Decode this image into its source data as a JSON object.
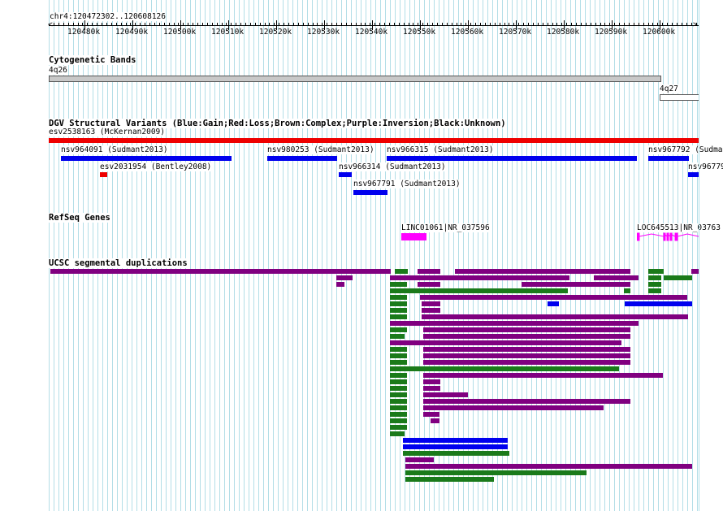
{
  "ruler": {
    "position": "chr4:120472302..120608126",
    "ticks": [
      "120480k",
      "120490k",
      "120500k",
      "120510k",
      "120520k",
      "120530k",
      "120540k",
      "120550k",
      "120560k",
      "120570k",
      "120580k",
      "120590k",
      "120600k"
    ]
  },
  "tracks": {
    "cytoband": {
      "title": "Cytogenetic Bands",
      "bands": [
        {
          "label": "4q26",
          "color": "#c8c8c8"
        },
        {
          "label": "4q27",
          "color": "#ffffff"
        }
      ]
    },
    "dgv": {
      "title": "DGV Structural Variants (Blue:Gain;Red:Loss;Brown:Complex;Purple:Inversion;Black:Unknown)",
      "variants": [
        {
          "label": "esv2538163 (McKernan2009)",
          "type": "loss"
        },
        {
          "label": "nsv964091 (Sudmant2013)",
          "type": "gain"
        },
        {
          "label": "nsv980253 (Sudmant2013)",
          "type": "gain"
        },
        {
          "label": "nsv966315 (Sudmant2013)",
          "type": "gain"
        },
        {
          "label": "nsv967792 (Sudma",
          "type": "gain"
        },
        {
          "label": "esv2031954 (Bentley2008)",
          "type": "loss"
        },
        {
          "label": "nsv966314 (Sudmant2013)",
          "type": "gain"
        },
        {
          "label": "nsv96779",
          "type": "gain"
        },
        {
          "label": "nsv967791 (Sudmant2013)",
          "type": "gain"
        }
      ]
    },
    "refseq": {
      "title": "RefSeq Genes",
      "genes": [
        {
          "label": "LINC01061|NR_037596"
        },
        {
          "label": "LOC645513|NR_03763"
        }
      ]
    },
    "segdup": {
      "title": "UCSC segmental duplications"
    }
  },
  "colors": {
    "gain": "#0000ee",
    "loss": "#ee0000",
    "gene": "#ff00ff",
    "segdup_purple": "#800080",
    "segdup_green": "#1a7a1a",
    "segdup_blue": "#0000ee",
    "grid": "#b3dee7"
  }
}
